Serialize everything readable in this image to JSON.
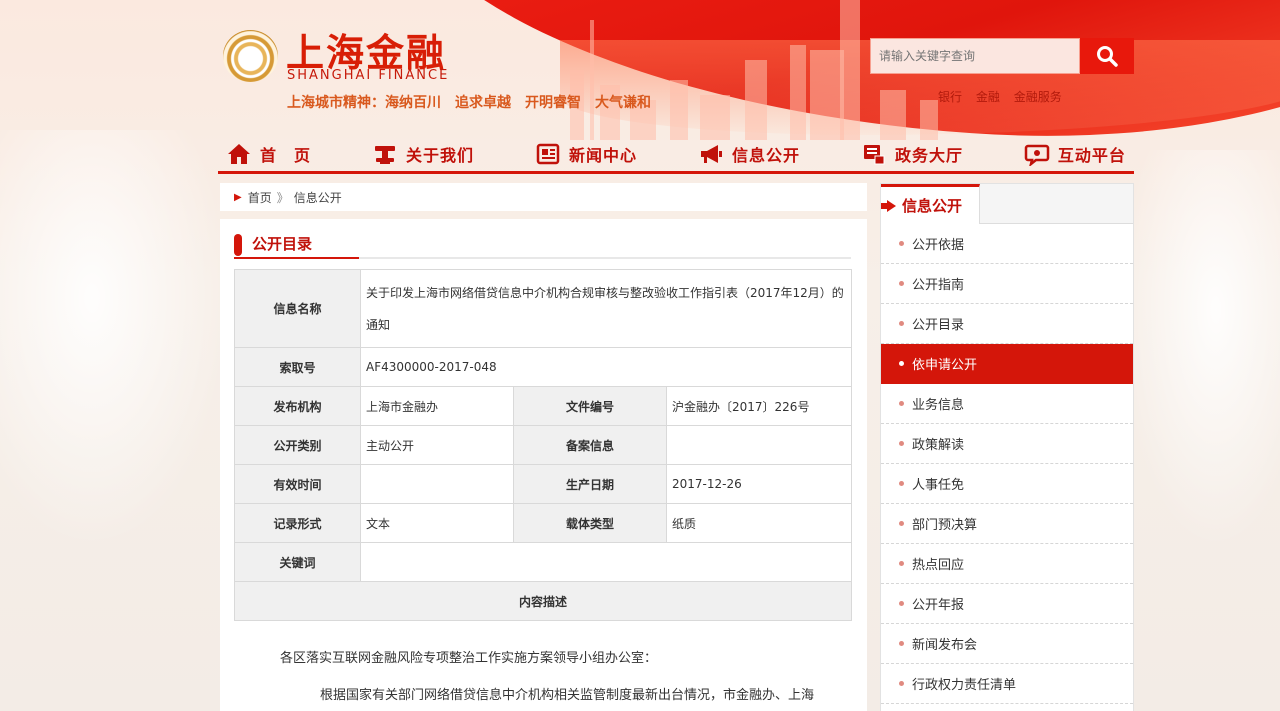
{
  "header": {
    "logo_cn": "上海金融",
    "logo_en": "SHANGHAI FINANCE",
    "slogan": "上海城市精神：海纳百川　追求卓越　开明睿智　大气谦和",
    "search": {
      "placeholder": "请输入关键字查询"
    },
    "hot_links": [
      "银行",
      "金融",
      "金融服务"
    ]
  },
  "nav": {
    "items": [
      {
        "label": "首　页",
        "icon": "home-icon"
      },
      {
        "label": "关于我们",
        "icon": "stamp-icon"
      },
      {
        "label": "新闻中心",
        "icon": "newspaper-icon"
      },
      {
        "label": "信息公开",
        "icon": "megaphone-icon"
      },
      {
        "label": "政务大厅",
        "icon": "service-hall-icon"
      },
      {
        "label": "互动平台",
        "icon": "chat-icon"
      }
    ]
  },
  "breadcrumb": {
    "home": "首页",
    "separator": "》",
    "current": "信息公开"
  },
  "main": {
    "section_title": "公开目录",
    "table": {
      "name_label": "信息名称",
      "name_value": "关于印发上海市网络借贷信息中介机构合规审核与整改验收工作指引表（2017年12月）的通知",
      "index_label": "索取号",
      "index_value": "AF4300000-2017-048",
      "org_label": "发布机构",
      "org_value": "上海市金融办",
      "doc_no_label": "文件编号",
      "doc_no_value": "沪金融办〔2017〕226号",
      "category_label": "公开类别",
      "category_value": "主动公开",
      "record_label": "备案信息",
      "record_value": "",
      "valid_label": "有效时间",
      "valid_value": "",
      "date_label": "生产日期",
      "date_value": "2017-12-26",
      "format_label": "记录形式",
      "format_value": "文本",
      "carrier_label": "载体类型",
      "carrier_value": "纸质",
      "keyword_label": "关键词",
      "keyword_value": "",
      "desc_label": "内容描述"
    },
    "body": [
      "各区落实互联网金融风险专项整治工作实施方案领导小组办公室：",
      "根据国家有关部门网络借贷信息中介机构相关监管制度最新出台情况，市金融办、上海"
    ]
  },
  "sidebar": {
    "title": "信息公开",
    "items": [
      "公开依据",
      "公开指南",
      "公开目录",
      "依申请公开",
      "业务信息",
      "政策解读",
      "人事任免",
      "部门预决算",
      "热点回应",
      "公开年报",
      "新闻发布会",
      "行政权力责任清单"
    ],
    "active_index": 3
  },
  "colors": {
    "brand_red": "#d4160a",
    "title_red": "#c0110a"
  }
}
